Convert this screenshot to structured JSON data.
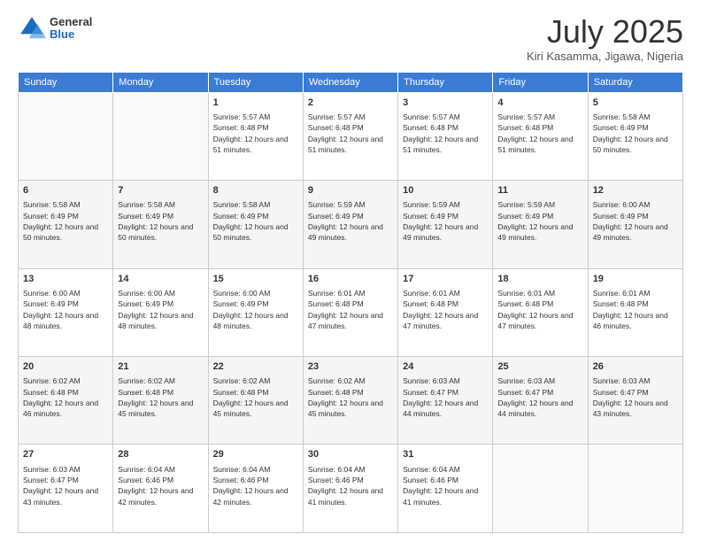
{
  "logo": {
    "general": "General",
    "blue": "Blue"
  },
  "title": {
    "month_year": "July 2025",
    "location": "Kiri Kasamma, Jigawa, Nigeria"
  },
  "weekdays": [
    "Sunday",
    "Monday",
    "Tuesday",
    "Wednesday",
    "Thursday",
    "Friday",
    "Saturday"
  ],
  "weeks": [
    [
      {
        "day": "",
        "info": ""
      },
      {
        "day": "",
        "info": ""
      },
      {
        "day": "1",
        "info": "Sunrise: 5:57 AM\nSunset: 6:48 PM\nDaylight: 12 hours and 51 minutes."
      },
      {
        "day": "2",
        "info": "Sunrise: 5:57 AM\nSunset: 6:48 PM\nDaylight: 12 hours and 51 minutes."
      },
      {
        "day": "3",
        "info": "Sunrise: 5:57 AM\nSunset: 6:48 PM\nDaylight: 12 hours and 51 minutes."
      },
      {
        "day": "4",
        "info": "Sunrise: 5:57 AM\nSunset: 6:48 PM\nDaylight: 12 hours and 51 minutes."
      },
      {
        "day": "5",
        "info": "Sunrise: 5:58 AM\nSunset: 6:49 PM\nDaylight: 12 hours and 50 minutes."
      }
    ],
    [
      {
        "day": "6",
        "info": "Sunrise: 5:58 AM\nSunset: 6:49 PM\nDaylight: 12 hours and 50 minutes."
      },
      {
        "day": "7",
        "info": "Sunrise: 5:58 AM\nSunset: 6:49 PM\nDaylight: 12 hours and 50 minutes."
      },
      {
        "day": "8",
        "info": "Sunrise: 5:58 AM\nSunset: 6:49 PM\nDaylight: 12 hours and 50 minutes."
      },
      {
        "day": "9",
        "info": "Sunrise: 5:59 AM\nSunset: 6:49 PM\nDaylight: 12 hours and 49 minutes."
      },
      {
        "day": "10",
        "info": "Sunrise: 5:59 AM\nSunset: 6:49 PM\nDaylight: 12 hours and 49 minutes."
      },
      {
        "day": "11",
        "info": "Sunrise: 5:59 AM\nSunset: 6:49 PM\nDaylight: 12 hours and 49 minutes."
      },
      {
        "day": "12",
        "info": "Sunrise: 6:00 AM\nSunset: 6:49 PM\nDaylight: 12 hours and 49 minutes."
      }
    ],
    [
      {
        "day": "13",
        "info": "Sunrise: 6:00 AM\nSunset: 6:49 PM\nDaylight: 12 hours and 48 minutes."
      },
      {
        "day": "14",
        "info": "Sunrise: 6:00 AM\nSunset: 6:49 PM\nDaylight: 12 hours and 48 minutes."
      },
      {
        "day": "15",
        "info": "Sunrise: 6:00 AM\nSunset: 6:49 PM\nDaylight: 12 hours and 48 minutes."
      },
      {
        "day": "16",
        "info": "Sunrise: 6:01 AM\nSunset: 6:48 PM\nDaylight: 12 hours and 47 minutes."
      },
      {
        "day": "17",
        "info": "Sunrise: 6:01 AM\nSunset: 6:48 PM\nDaylight: 12 hours and 47 minutes."
      },
      {
        "day": "18",
        "info": "Sunrise: 6:01 AM\nSunset: 6:48 PM\nDaylight: 12 hours and 47 minutes."
      },
      {
        "day": "19",
        "info": "Sunrise: 6:01 AM\nSunset: 6:48 PM\nDaylight: 12 hours and 46 minutes."
      }
    ],
    [
      {
        "day": "20",
        "info": "Sunrise: 6:02 AM\nSunset: 6:48 PM\nDaylight: 12 hours and 46 minutes."
      },
      {
        "day": "21",
        "info": "Sunrise: 6:02 AM\nSunset: 6:48 PM\nDaylight: 12 hours and 45 minutes."
      },
      {
        "day": "22",
        "info": "Sunrise: 6:02 AM\nSunset: 6:48 PM\nDaylight: 12 hours and 45 minutes."
      },
      {
        "day": "23",
        "info": "Sunrise: 6:02 AM\nSunset: 6:48 PM\nDaylight: 12 hours and 45 minutes."
      },
      {
        "day": "24",
        "info": "Sunrise: 6:03 AM\nSunset: 6:47 PM\nDaylight: 12 hours and 44 minutes."
      },
      {
        "day": "25",
        "info": "Sunrise: 6:03 AM\nSunset: 6:47 PM\nDaylight: 12 hours and 44 minutes."
      },
      {
        "day": "26",
        "info": "Sunrise: 6:03 AM\nSunset: 6:47 PM\nDaylight: 12 hours and 43 minutes."
      }
    ],
    [
      {
        "day": "27",
        "info": "Sunrise: 6:03 AM\nSunset: 6:47 PM\nDaylight: 12 hours and 43 minutes."
      },
      {
        "day": "28",
        "info": "Sunrise: 6:04 AM\nSunset: 6:46 PM\nDaylight: 12 hours and 42 minutes."
      },
      {
        "day": "29",
        "info": "Sunrise: 6:04 AM\nSunset: 6:46 PM\nDaylight: 12 hours and 42 minutes."
      },
      {
        "day": "30",
        "info": "Sunrise: 6:04 AM\nSunset: 6:46 PM\nDaylight: 12 hours and 41 minutes."
      },
      {
        "day": "31",
        "info": "Sunrise: 6:04 AM\nSunset: 6:46 PM\nDaylight: 12 hours and 41 minutes."
      },
      {
        "day": "",
        "info": ""
      },
      {
        "day": "",
        "info": ""
      }
    ]
  ]
}
